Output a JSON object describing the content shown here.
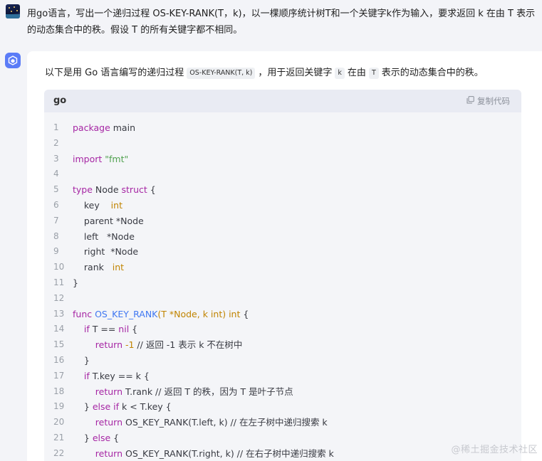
{
  "user_message": {
    "text": "用go语言，写出一个递归过程 OS-KEY-RANK(T，k)，以一棵顺序统计树T和一个关键字k作为输入，要求返回 k 在由 T 表示的动态集合中的秩。假设 T 的所有关键字都不相同。"
  },
  "assistant": {
    "intro_prefix": "以下是用 Go 语言编写的递归过程",
    "intro_code": "OS-KEY-RANK(T, k)",
    "intro_mid1": "，用于返回关键字",
    "intro_code_k": "k",
    "intro_mid2": "在由",
    "intro_code_t": "T",
    "intro_suffix": "表示的动态集合中的秩。"
  },
  "code_block": {
    "language": "go",
    "copy_label": "复制代码",
    "lines": [
      {
        "n": "1"
      },
      {
        "n": "2"
      },
      {
        "n": "3"
      },
      {
        "n": "4"
      },
      {
        "n": "5"
      },
      {
        "n": "6"
      },
      {
        "n": "7"
      },
      {
        "n": "8"
      },
      {
        "n": "9"
      },
      {
        "n": "10"
      },
      {
        "n": "11"
      },
      {
        "n": "12"
      },
      {
        "n": "13"
      },
      {
        "n": "14"
      },
      {
        "n": "15"
      },
      {
        "n": "16"
      },
      {
        "n": "17"
      },
      {
        "n": "18"
      },
      {
        "n": "19"
      },
      {
        "n": "20"
      },
      {
        "n": "21"
      },
      {
        "n": "22"
      }
    ],
    "tokens": {
      "l1a": "package",
      "l1b": " main",
      "l3a": "import",
      "l3b": " \"fmt\"",
      "l5a": "type",
      "l5b": " Node ",
      "l5c": "struct",
      "l5d": " {",
      "l6a": "    key    ",
      "l6b": "int",
      "l7a": "    parent *Node",
      "l8a": "    left   *Node",
      "l9a": "    right  *Node",
      "l10a": "    rank   ",
      "l10b": "int",
      "l11a": "}",
      "l13a": "func",
      "l13b": " OS_KEY_RANK",
      "l13c": "(T *Node, k ",
      "l13d": "int",
      "l13e": ") ",
      "l13f": "int",
      "l13g": " {",
      "l14a": "    if",
      "l14b": " T == ",
      "l14c": "nil",
      "l14d": " {",
      "l15a": "        return",
      "l15b": " -1",
      "l15c": " // 返回 -1 表示 k 不在树中",
      "l16a": "    }",
      "l17a": "    if",
      "l17b": " T.key == k {",
      "l18a": "        return",
      "l18b": " T.rank // 返回 T 的秩，因为 T 是叶子节点",
      "l19a": "    } ",
      "l19b": "else if",
      "l19c": " k < T.key {",
      "l20a": "        return",
      "l20b": " OS_KEY_RANK(T.left, k) // 在左子树中递归搜索 k",
      "l21a": "    } ",
      "l21b": "else",
      "l21c": " {",
      "l22a": "        return",
      "l22b": " OS_KEY_RANK(T.right, k) // 在右子树中递归搜索 k"
    }
  },
  "watermark": "@稀土掘金技术社区",
  "icons": [
    "user-avatar",
    "assistant-logo-icon",
    "copy-icon"
  ]
}
